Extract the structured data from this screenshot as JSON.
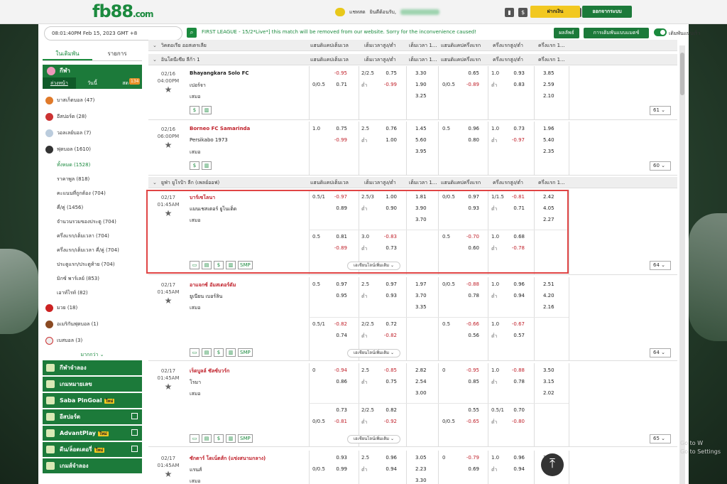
{
  "site": {
    "logo": "fb88",
    "logo_suffix": ".com"
  },
  "topbar": {
    "chat": "แชทสด",
    "greeting": "ยินดีต้อนรับ,",
    "deposit": "ฝากเงิน",
    "logout": "ออกจากระบบ"
  },
  "toolbar": {
    "datetime": "08:01:40PM Feb 15, 2023 GMT +8",
    "marquee": "FIRST LEAGUE - 15/2*Live*] this match will be removed from our website. Sorry for the inconvenience caused!",
    "results": "ผลลัพธ์",
    "sort": "การเดิมพันแบบแมตช์",
    "fast_bet": "เดิมพันแบบเร็ว"
  },
  "sidebar": {
    "tabs": [
      "ในเดิมพัน",
      "รายการ"
    ],
    "sport_title": "กีฬา",
    "subtabs": [
      "ล่วงหน้า",
      "วันนี้",
      "สด"
    ],
    "live_count": "134",
    "sports": [
      {
        "label": "บาสเก็ตบอล (47)"
      },
      {
        "label": "อีสปอร์ต (28)"
      },
      {
        "label": "วอลเลย์บอล (7)"
      },
      {
        "label": "ฟุตบอล (1610)"
      }
    ],
    "soccer_sub": [
      {
        "label": "ทั้งหมด (1528)"
      },
      {
        "label": "ราคาพูล (818)"
      },
      {
        "label": "คะแนนที่ถูกต้อง (704)"
      },
      {
        "label": "คี่/คู่ (1456)"
      },
      {
        "label": "จำนวนรวมของประตู (704)"
      },
      {
        "label": "ครึ่งแรก/เต็มเวลา (704)"
      },
      {
        "label": "ครึ่งแรก/เต็มเวลา คี่/คู่ (704)"
      },
      {
        "label": "ประตูแรก/ประตูท้าย (704)"
      },
      {
        "label": "มิกซ์ พาร์เลย์ (853)"
      },
      {
        "label": "เอาท์ไรท์ (82)"
      }
    ],
    "sports2": [
      {
        "label": "มวย (18)"
      },
      {
        "label": "อเมริกันฟุตบอล (1)"
      },
      {
        "label": "เบสบอล (3)"
      }
    ],
    "more": "มากกว่า",
    "games": [
      {
        "label": "กีฬาจำลอง",
        "new": ""
      },
      {
        "label": "เกมหมายเลข",
        "new": ""
      },
      {
        "label": "Saba PinGoal",
        "new": "ใหม่"
      },
      {
        "label": "อีสปอร์ต",
        "new": ""
      },
      {
        "label": "AdvantPlay",
        "new": "ใหม่"
      },
      {
        "label": "ดีน/ล็อตเตอรี่",
        "new": "ใหม่"
      },
      {
        "label": "เกมส์จำลอง",
        "new": ""
      }
    ]
  },
  "columns": {
    "hdp_ft": "แฮนดิแคปเต็มเวล",
    "ou_ft": "เต็มเวลาสูง/ต่ำ",
    "x12_ft": "เต็มเวลา 1...",
    "hdp_1h": "แฮนดิแคปครึ่งแรก",
    "ou_1h": "ครึ่งแรกสูง/ต่ำ",
    "x12_1h": "ครึ่งแรก 1..."
  },
  "leagues": {
    "l0": "วิคตอเรีย ออสเตรเลีย",
    "l1": "อินโดนีเซีย ลีก้า 1",
    "l2": "ยูฟ่า ยูโรป้า ลีก (เพลย์ออฟ)"
  },
  "labels": {
    "draw": "เสมอ",
    "under": "ต่ำ",
    "more_bets": "เอเชียนไลน์เพิ่มเติม",
    "smp": "SMP"
  },
  "matches": [
    {
      "date": "02/16",
      "time": "04:00PM",
      "home": "Bhayangkara Solo FC",
      "away": "เปอร์จา",
      "count": "61",
      "ft": {
        "hc": [
          "",
          "0/0.5"
        ],
        "hdp": [
          "-0.95",
          "0.71"
        ],
        "ou": [
          "2/2.5",
          ""
        ],
        "ouo": [
          "0.75",
          "-0.99"
        ],
        "x": [
          "3.30",
          "1.90",
          "3.25"
        ]
      },
      "h1": {
        "hc": [
          "",
          "0/0.5"
        ],
        "hdp": [
          "0.65",
          "-0.89"
        ],
        "ou": [
          "1.0",
          ""
        ],
        "ouo": [
          "0.93",
          "0.83"
        ],
        "x": [
          "3.85",
          "2.59",
          "2.10"
        ]
      }
    },
    {
      "date": "02/16",
      "time": "06:00PM",
      "home": "Borneo FC Samarinda",
      "away": "Persikabo 1973",
      "count": "60",
      "ft": {
        "hc": [
          "1.0",
          ""
        ],
        "hdp": [
          "0.75",
          "-0.99"
        ],
        "ou": [
          "2.5",
          ""
        ],
        "ouo": [
          "0.76",
          "1.00"
        ],
        "x": [
          "1.45",
          "5.60",
          "3.95"
        ]
      },
      "h1": {
        "hc": [
          "0.5",
          ""
        ],
        "hdp": [
          "0.96",
          "0.80"
        ],
        "ou": [
          "1.0",
          ""
        ],
        "ouo": [
          "0.73",
          "-0.97"
        ],
        "x": [
          "1.96",
          "5.40",
          "2.35"
        ]
      }
    },
    {
      "date": "02/17",
      "time": "01:45AM",
      "home": "บาร์เซโลนา",
      "away": "แมนเชสเตอร์ ยูไนเต็ด",
      "count": "64",
      "ft": {
        "hc": [
          "0.5/1",
          ""
        ],
        "hdp": [
          "-0.97",
          "0.89"
        ],
        "ou": [
          "2.5/3",
          ""
        ],
        "ouo": [
          "1.00",
          "0.90"
        ],
        "x": [
          "1.81",
          "3.90",
          "3.70"
        ]
      },
      "h1": {
        "hc": [
          "0/0.5",
          ""
        ],
        "hdp": [
          "0.97",
          "0.93"
        ],
        "ou": [
          "1/1.5",
          ""
        ],
        "ouo": [
          "-0.81",
          "0.71"
        ],
        "x": [
          "2.42",
          "4.05",
          "2.27"
        ]
      },
      "alt": {
        "hc": "0.5",
        "hdp": [
          "0.81",
          "-0.89"
        ],
        "ou": "3.0",
        "ouo": [
          "-0.83",
          "0.73"
        ],
        "hc1": "0.5",
        "hdp1": [
          "-0.70",
          "0.60"
        ],
        "ou1": "1.0",
        "ouo1": [
          "0.68",
          "-0.78"
        ]
      }
    },
    {
      "date": "02/17",
      "time": "01:45AM",
      "home": "อาแจกซ์ อัมสเตอร์ดัม",
      "away": "ยูเนียน เบอร์ลิน",
      "count": "64",
      "ft": {
        "hc": [
          "0.5",
          ""
        ],
        "hdp": [
          "0.97",
          "0.95"
        ],
        "ou": [
          "2.5",
          ""
        ],
        "ouo": [
          "0.97",
          "0.93"
        ],
        "x": [
          "1.97",
          "3.70",
          "3.35"
        ]
      },
      "h1": {
        "hc": [
          "0/0.5",
          ""
        ],
        "hdp": [
          "-0.88",
          "0.78"
        ],
        "ou": [
          "1.0",
          ""
        ],
        "ouo": [
          "0.96",
          "0.94"
        ],
        "x": [
          "2.51",
          "4.20",
          "2.16"
        ]
      },
      "alt": {
        "hc": "0.5/1",
        "hdp": [
          "-0.82",
          "0.74"
        ],
        "ou": "2/2.5",
        "ouo": [
          "0.72",
          "-0.82"
        ],
        "hc1": "0.5",
        "hdp1": [
          "-0.66",
          "0.56"
        ],
        "ou1": "1.0",
        "ouo1": [
          "-0.67",
          "0.57"
        ]
      }
    },
    {
      "date": "02/17",
      "time": "01:45AM",
      "home": "เร็ดบูลล์ ซัลซ์บวร์ก",
      "away": "โรมา",
      "count": "65",
      "ft": {
        "hc": [
          "0",
          ""
        ],
        "hdp": [
          "-0.94",
          "0.86"
        ],
        "ou": [
          "2.5",
          ""
        ],
        "ouo": [
          "-0.85",
          "0.75"
        ],
        "x": [
          "2.82",
          "2.54",
          "3.00"
        ]
      },
      "h1": {
        "hc": [
          "0",
          ""
        ],
        "hdp": [
          "-0.95",
          "0.85"
        ],
        "ou": [
          "1.0",
          ""
        ],
        "ouo": [
          "-0.88",
          "0.78"
        ],
        "x": [
          "3.50",
          "3.15",
          "2.02"
        ]
      },
      "alt": {
        "hc": "",
        "hdp": [
          "0.73",
          "-0.81"
        ],
        "ou": "2/2.5",
        "ouo": [
          "0.82",
          "-0.92"
        ],
        "hc1": "",
        "hdp1": [
          "0.55",
          "-0.65"
        ],
        "ou1": "0.5/1",
        "ouo1": [
          "0.70",
          "-0.80"
        ]
      },
      "alt_hc_away": "0/0.5",
      "alt_hc1_away": "0/0.5"
    },
    {
      "date": "02/17",
      "time": "01:45AM",
      "home": "ซักตาร์ โดเน็ตส์ก (แข่งสนามกลาง)",
      "away": "แรนส์",
      "count": "",
      "ft": {
        "hc": [
          "",
          "0/0.5"
        ],
        "hdp": [
          "0.93",
          "0.99"
        ],
        "ou": [
          "2.5",
          ""
        ],
        "ouo": [
          "0.96",
          "0.94"
        ],
        "x": [
          "3.05",
          "2.23",
          "3.30"
        ]
      },
      "h1": {
        "hc": [
          "0",
          ""
        ],
        "hdp": [
          "-0.79",
          "0.69"
        ],
        "ou": [
          "1.0",
          ""
        ],
        "ouo": [
          "0.96",
          "0.94"
        ],
        "x": [
          "3.75",
          "2.11",
          ""
        ]
      }
    }
  ],
  "watermark": [
    "Go to W",
    "Go to Settings"
  ],
  "colors": {
    "accent": "#1c7a3a",
    "negative": "#c0202a",
    "highlight": "#e04545"
  }
}
